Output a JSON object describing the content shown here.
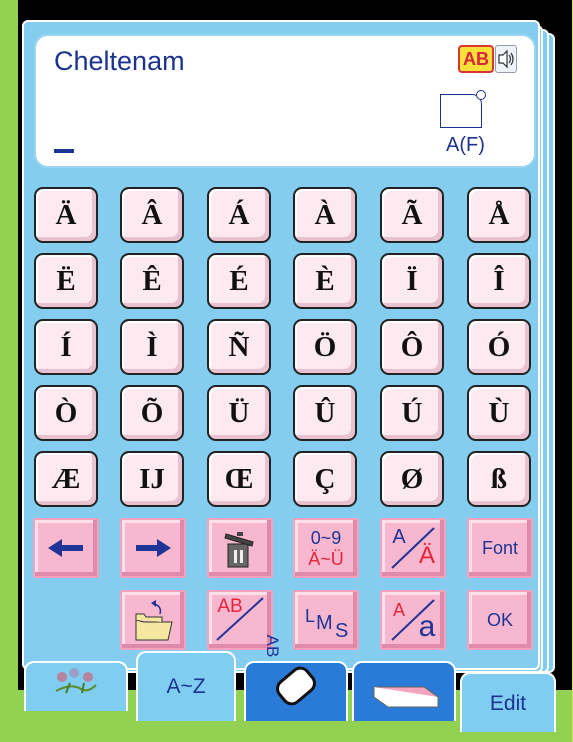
{
  "display": {
    "font_name": "Cheltenam",
    "case_badge": "AB",
    "shape_label": "A(F)"
  },
  "character_keys": [
    [
      "Ä",
      "Â",
      "Á",
      "À",
      "Ã",
      "Å"
    ],
    [
      "Ë",
      "Ê",
      "É",
      "È",
      "Ï",
      "Î"
    ],
    [
      "Í",
      "Ì",
      "Ñ",
      "Ö",
      "Ô",
      "Ó"
    ],
    [
      "Ò",
      "Õ",
      "Ü",
      "Û",
      "Ú",
      "Ù"
    ],
    [
      "Æ",
      "IJ",
      "Œ",
      "Ç",
      "Ø",
      "ß"
    ]
  ],
  "function_keys": {
    "numbers_top": "0~9",
    "numbers_bottom": "Ä~Ü",
    "accent_top": "A",
    "accent_bottom": "Ä",
    "font_label": "Font",
    "case_top": "AB",
    "case_bottom": "AB",
    "size_l": "L",
    "size_m": "M",
    "size_s": "S",
    "lower_top": "A",
    "lower_bottom": "a",
    "ok_label": "OK"
  },
  "tabs": {
    "az_label": "A~Z",
    "edit_label": "Edit"
  },
  "colors": {
    "key_face": "#fdeaf0",
    "function_key": "#f7b7ce",
    "panel": "#84cdef",
    "text_blue": "#1b3391",
    "accent_red": "#e5243b",
    "rail_green": "#93d152"
  },
  "icons": {
    "left": "arrow-left-icon",
    "right": "arrow-right-icon",
    "trash": "trash-icon",
    "folder": "open-folder-icon",
    "embroidery": "embroidery-tab-icon",
    "eraser": "eraser-icon",
    "sewing": "sewing-tab-icon",
    "speaker": "speaker-icon"
  }
}
